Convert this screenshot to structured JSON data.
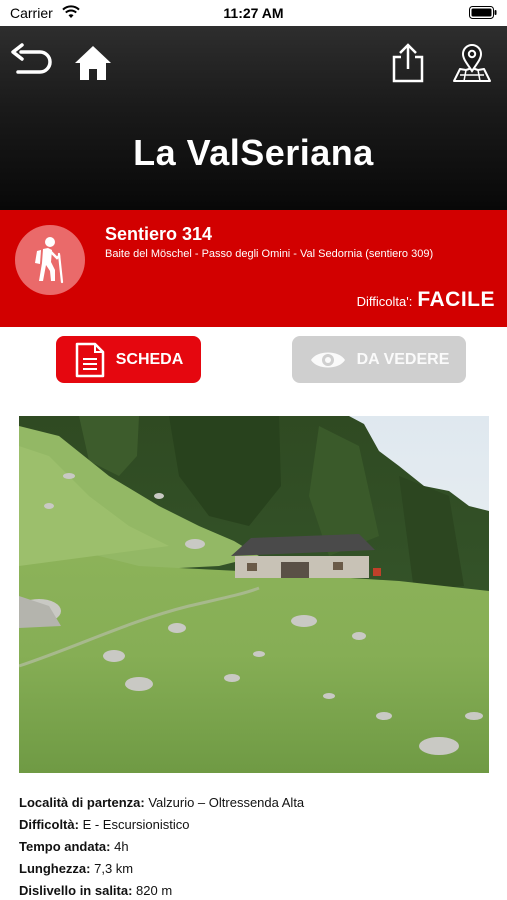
{
  "status_bar": {
    "carrier": "Carrier",
    "time": "11:27 AM"
  },
  "header": {
    "title": "La ValSeriana",
    "icons": [
      "back-arrow-icon",
      "home-icon",
      "share-icon",
      "map-pin-icon"
    ]
  },
  "trail": {
    "name": "Sentiero 314",
    "route": "Baite del Möschel - Passo degli Omini - Val Sedornia (sentiero 309)",
    "difficulty_label": "Difficolta':",
    "difficulty_value": "FACILE",
    "icon": "hiker-icon"
  },
  "tabs": [
    {
      "label": "SCHEDA",
      "icon": "document-icon",
      "active": true
    },
    {
      "label": "DA VEDERE",
      "icon": "eye-icon",
      "active": false
    }
  ],
  "details": [
    {
      "label": "Località di partenza:",
      "value": " Valzurio – Oltressenda Alta"
    },
    {
      "label": "Difficoltà:",
      "value": " E - Escursionistico"
    },
    {
      "label": "Tempo andata:",
      "value": " 4h"
    },
    {
      "label": "Lunghezza:",
      "value": " 7,3 km"
    },
    {
      "label": "Dislivello in salita:",
      "value": " 820 m"
    }
  ],
  "colors": {
    "brand_red": "#d20000",
    "button_red": "#e5070f",
    "inactive_gray": "#cfcfcf",
    "header_dark": "#1a1a1a"
  }
}
